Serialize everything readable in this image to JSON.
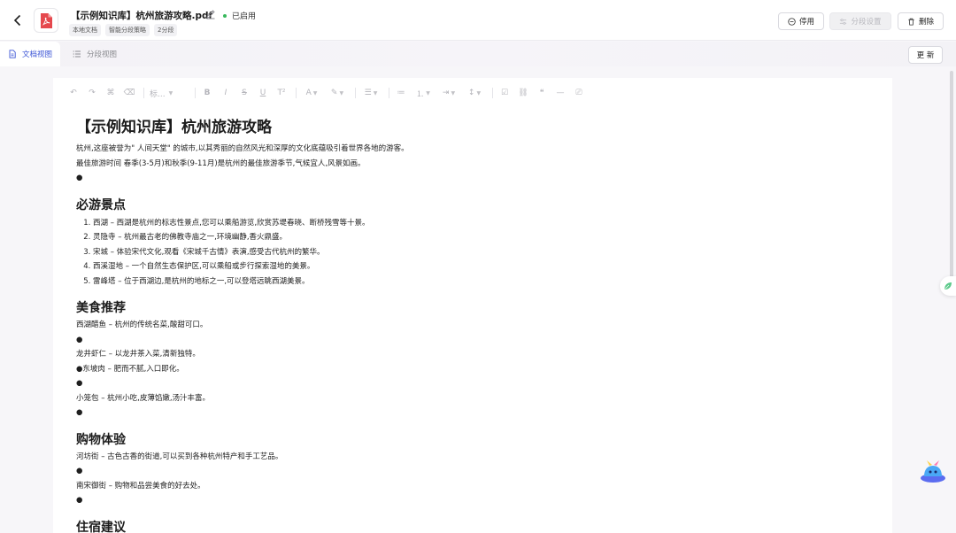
{
  "header": {
    "file_name": "【示例知识库】杭州旅游攻略.pdf",
    "status": "已启用",
    "tags": [
      "本地文档",
      "智能分段策略",
      "2分段"
    ],
    "buttons": {
      "disable": "停用",
      "segment_settings": "分段设置",
      "delete": "删除"
    }
  },
  "tabs": {
    "doc_view": "文档视图",
    "segment_view": "分段视图"
  },
  "update_button": "更 新",
  "toolbar": {
    "heading_select": "标..."
  },
  "document": {
    "title": "【示例知识库】杭州旅游攻略",
    "intro": [
      "杭州,这座被誉为\" 人间天堂\" 的城市,以其秀丽的自然风光和深厚的文化底蕴吸引着世界各地的游客。",
      "最佳旅游时间 春季(3-5月)和秋季(9-11月)是杭州的最佳旅游季节,气候宜人,风景如画。",
      "●"
    ],
    "sections": [
      {
        "heading": "必游景点",
        "list": [
          "西湖 – 西湖是杭州的标志性景点,您可以乘船游览,欣赏苏堤春晓、断桥残雪等十景。",
          "灵隐寺 – 杭州最古老的佛教寺庙之一,环境幽静,香火鼎盛。",
          "宋城 – 体验宋代文化,观看《宋城千古情》表演,感受古代杭州的繁华。",
          "西溪湿地 – 一个自然生态保护区,可以乘船或步行探索湿地的美景。",
          "雷峰塔 – 位于西湖边,是杭州的地标之一,可以登塔远眺西湖美景。"
        ]
      },
      {
        "heading": "美食推荐",
        "lines": [
          "西湖醋鱼 – 杭州的传统名菜,酸甜可口。",
          "●",
          "龙井虾仁 – 以龙井茶入菜,清新独特。",
          "●东坡肉 – 肥而不腻,入口即化。",
          "●",
          "小笼包 – 杭州小吃,皮薄馅嫩,汤汁丰富。",
          "●"
        ]
      },
      {
        "heading": "购物体验",
        "lines": [
          "河坊街 – 古色古香的街道,可以买到各种杭州特产和手工艺品。",
          "●",
          "南宋御街 – 购物和品尝美食的好去处。",
          "●"
        ]
      },
      {
        "heading": "住宿建议",
        "lines": []
      }
    ]
  },
  "colors": {
    "accent": "#3d56d6",
    "status_green": "#38b85c",
    "pdf_red": "#e5484d"
  }
}
